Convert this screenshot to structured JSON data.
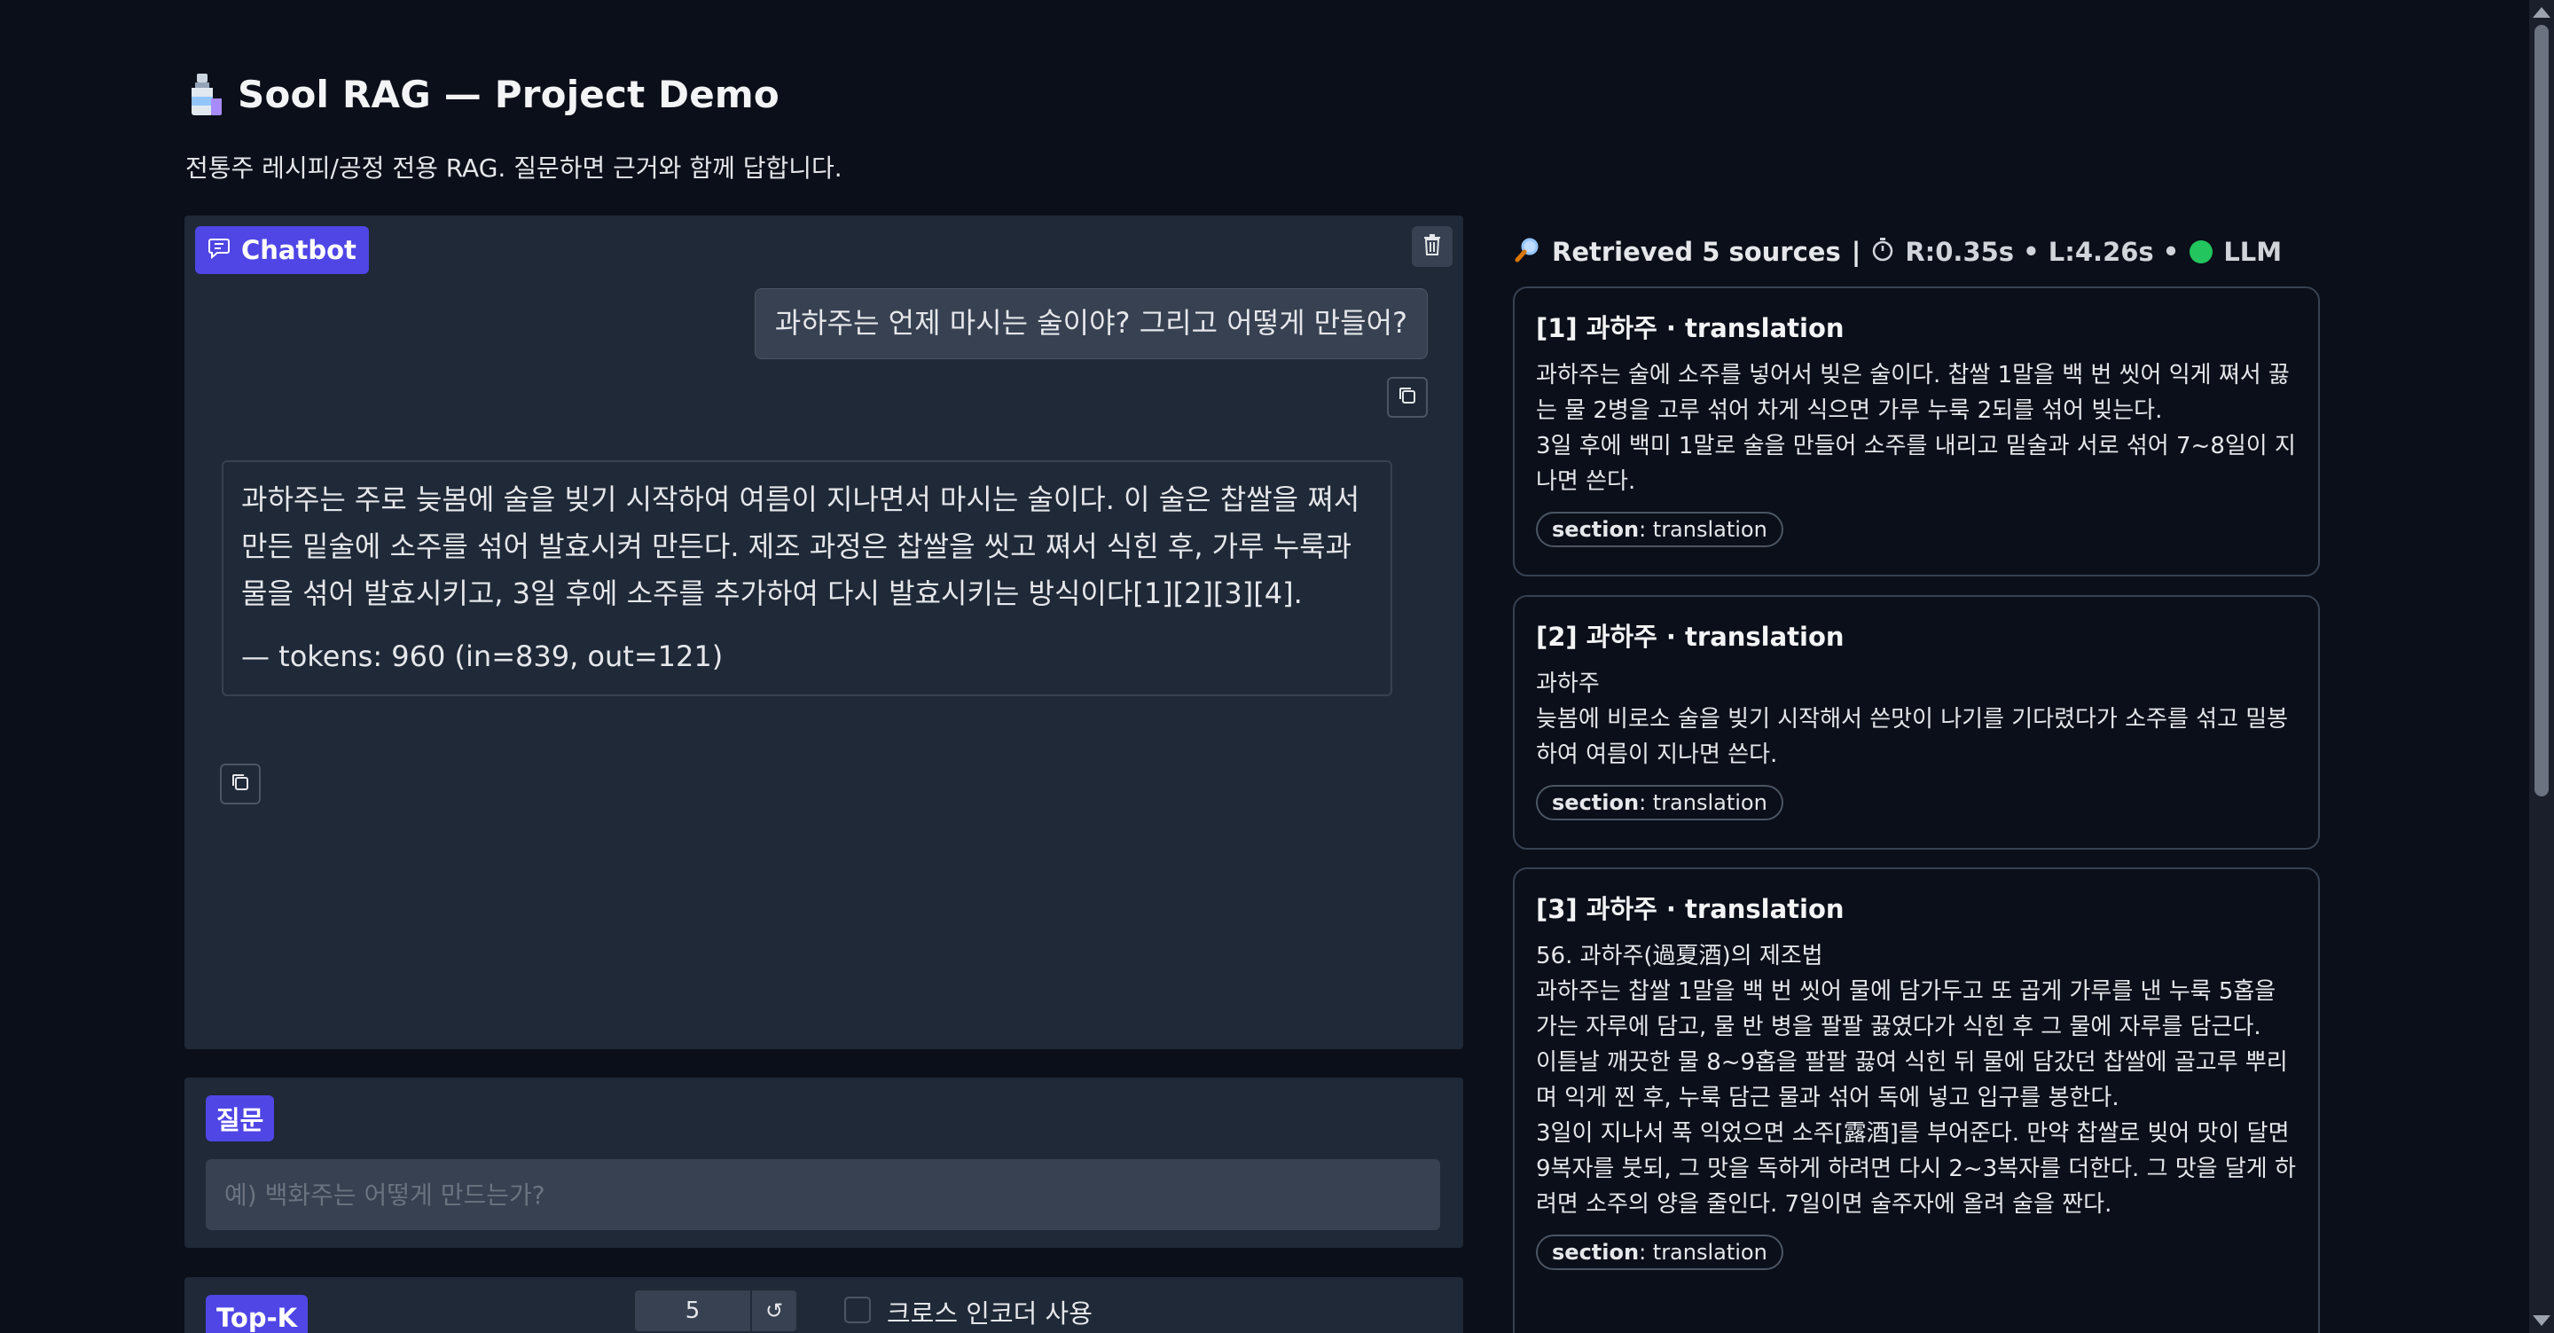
{
  "header": {
    "title": "Sool RAG — Project Demo",
    "subtitle": "전통주 레시피/공정 전용 RAG. 질문하면 근거와 함께 답합니다."
  },
  "chat": {
    "label": "Chatbot",
    "user_message": "과하주는 언제 마시는 술이야? 그리고 어떻게 만들어?",
    "bot_message": "과하주는 주로 늦봄에 술을 빚기 시작하여 여름이 지나면서 마시는 술이다. 이 술은 찹쌀을 쪄서 만든 밑술에 소주를 섞어 발효시켜 만든다. 제조 과정은 찹쌀을 씻고 쪄서 식힌 후, 가루 누룩과 물을 섞어 발효시키고, 3일 후에 소주를 추가하여 다시 발효시키는 방식이다[1][2][3][4].",
    "bot_tokens": "— tokens: 960 (in=839, out=121)"
  },
  "question": {
    "label": "질문",
    "placeholder": "예) 백화주는 어떻게 만드는가?"
  },
  "controls": {
    "topk_label": "Top-K",
    "topk_value": "5",
    "reset_symbol": "↺",
    "cross_encoder_label": "크로스 인코더 사용",
    "cross_encoder_checked": false
  },
  "sources": {
    "header_title": "Retrieved 5 sources",
    "separator": "|",
    "timing": "R:0.35s • L:4.26s •",
    "llm_label": "LLM",
    "status_color": "#22c55e",
    "items": [
      {
        "title": "[1] 과하주 · translation",
        "lines": [
          "과하주는 술에 소주를 넣어서 빚은 술이다. 찹쌀 1말을 백 번 씻어 익게 쪄서 끓는 물 2병을 고루 섞어 차게 식으면 가루 누룩 2되를 섞어 빚는다.",
          "3일 후에 백미 1말로 술을 만들어 소주를 내리고 밑술과 서로 섞어 7~8일이 지나면 쓴다."
        ],
        "section_key": "section",
        "section_value": ": translation"
      },
      {
        "title": "[2] 과하주 · translation",
        "lines": [
          "과하주",
          "늦봄에 비로소 술을 빚기 시작해서 쓴맛이 나기를 기다렸다가 소주를 섞고 밀봉하여 여름이 지나면 쓴다."
        ],
        "section_key": "section",
        "section_value": ": translation"
      },
      {
        "title": "[3] 과하주 · translation",
        "lines": [
          "56. 과하주(過夏酒)의 제조법",
          "과하주는 찹쌀 1말을 백 번 씻어 물에 담가두고 또 곱게 가루를 낸 누룩 5홉을 가는 자루에 담고, 물 반 병을 팔팔 끓였다가 식힌 후 그 물에 자루를 담근다.",
          "이튿날 깨끗한 물 8~9홉을 팔팔 끓여 식힌 뒤 물에 담갔던 찹쌀에 골고루 뿌리며 익게 찐 후, 누룩 담근 물과 섞어 독에 넣고 입구를 봉한다.",
          "3일이 지나서 푹 익었으면 소주[露酒]를 부어준다. 만약 찹쌀로 빚어 맛이 달면 9복자를 붓되, 그 맛을 독하게 하려면 다시 2~3복자를 더한다. 그 맛을 달게 하려면 소주의 양을 줄인다. 7일이면 술주자에 올려 술을 짠다."
        ],
        "section_key": "section",
        "section_value": ": translation"
      }
    ]
  },
  "colors": {
    "background": "#0b0f19",
    "panel": "#1f2937",
    "accent": "#4f46e5",
    "status_ok": "#22c55e"
  },
  "icons": {
    "logo": "bottle-icon",
    "chatbot": "chat-icon",
    "clear": "trash-icon",
    "copy": "copy-icon",
    "search": "magnifier-icon",
    "timer": "stopwatch-icon"
  }
}
